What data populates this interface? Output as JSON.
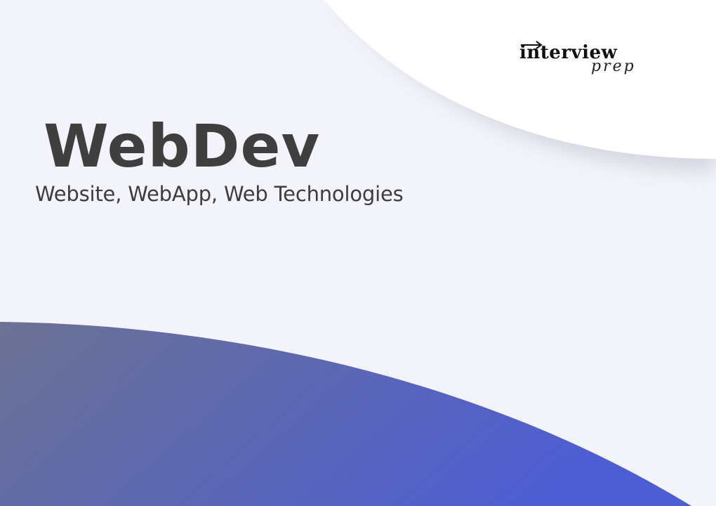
{
  "brand": {
    "logo_word": "interview",
    "logo_sub": "prep"
  },
  "hero": {
    "title": "WebDev",
    "subtitle": "Website, WebApp, Web Technologies"
  },
  "colors": {
    "background": "#f3f4fb",
    "text": "#3f3f3f",
    "wave_start": "#6b7294",
    "wave_end": "#4f5fd2",
    "corner_shape": "#ffffff"
  }
}
